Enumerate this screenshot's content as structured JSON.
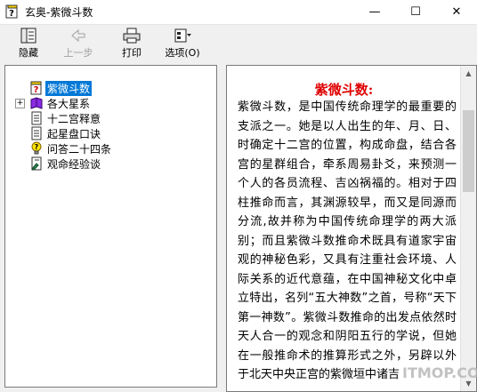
{
  "window": {
    "title": "玄奥-紫微斗数"
  },
  "window_controls": {
    "minimize": "—",
    "maximize": "☐",
    "close": "✕"
  },
  "toolbar": {
    "hide_label": "隐藏",
    "back_label": "上一步",
    "print_label": "打印",
    "options_label": "选项(O)"
  },
  "tree": {
    "items": [
      {
        "label": "紫微斗数",
        "icon": "help-book-icon",
        "selected": true
      },
      {
        "label": "各大星系",
        "icon": "book-icon",
        "expandable": true
      },
      {
        "label": "十二宫释意",
        "icon": "document-icon"
      },
      {
        "label": "起星盘口诀",
        "icon": "document-icon"
      },
      {
        "label": "问答二十四条",
        "icon": "question-bulb-icon"
      },
      {
        "label": "观命经验谈",
        "icon": "document-pen-icon"
      }
    ]
  },
  "content": {
    "title": "紫微斗数:",
    "body": "紫微斗数，是中国传统命理学的最重要的支派之一。她是以人出生的年、月、日、时确定十二宫的位置，构成命盘，结合各宫的星群组合，牵系周易卦爻，来预测一个人的各员流程、吉凶祸福的。相对于四柱推命而言，其渊源较早，而又是同源而分流,故并称为中国传统命理学的两大派别；而且紫微斗数推命术既具有道家宇宙观的神秘色彩，又具有注重社会环境、人际关系的近代意蕴，在中国神秘文化中卓立特出，名列“五大神数”之首，号称“天下第一神数”。紫微斗数推命的出发点依然时天人合一的观念和阴阳五行的学说，但她在一般推命术的推算形式之外，另辟以外于北天中央正宫的紫微垣中诸吉"
  },
  "watermark": "ITMOP.COM",
  "colors": {
    "selection": "#0078d7",
    "title_red": "#e00000"
  }
}
